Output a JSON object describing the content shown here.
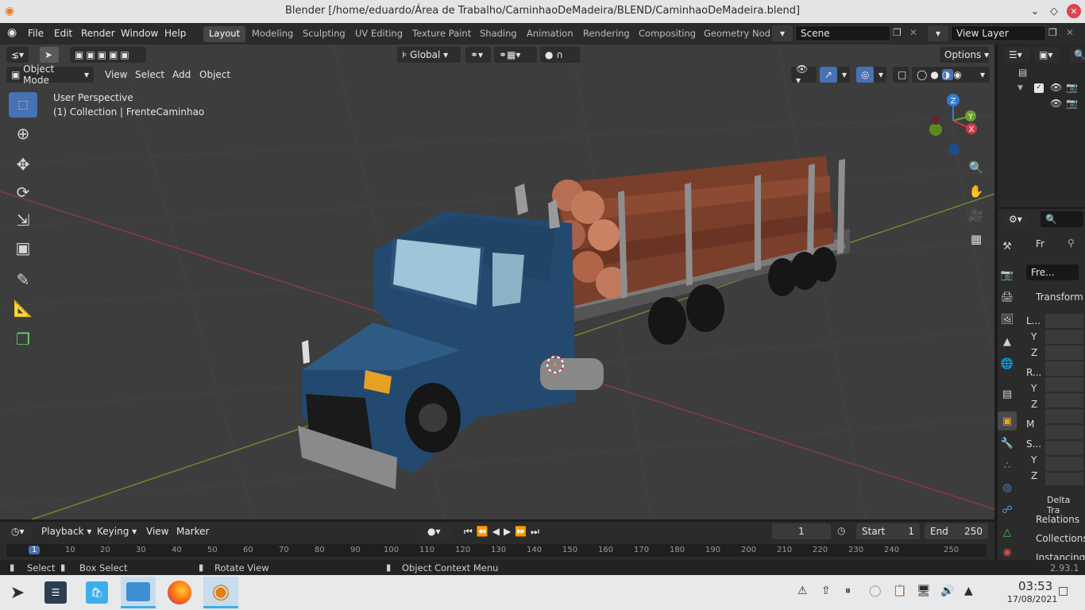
{
  "window": {
    "title": "Blender [/home/eduardo/Área de Trabalho/CaminhaoDeMadeira/BLEND/CaminhaoDeMadeira.blend]",
    "controls": [
      "chevron-down",
      "diamond",
      "close"
    ]
  },
  "menu": [
    "File",
    "Edit",
    "Render",
    "Window",
    "Help"
  ],
  "workspaces": [
    "Layout",
    "Modeling",
    "Sculpting",
    "UV Editing",
    "Texture Paint",
    "Shading",
    "Animation",
    "Rendering",
    "Compositing",
    "Geometry Nod"
  ],
  "active_workspace": "Layout",
  "scene": {
    "label": "Scene",
    "view_layer": "View Layer"
  },
  "toolbar": {
    "orientation": "Global",
    "options": "Options"
  },
  "viewport": {
    "mode": "Object Mode",
    "menus": [
      "View",
      "Select",
      "Add",
      "Object"
    ],
    "overlay_title": "User Perspective",
    "overlay_collection": "(1) Collection | FrenteCaminhao",
    "gizmo": {
      "z": "Z",
      "y": "Y",
      "x": "X"
    }
  },
  "properties": {
    "object_name_short": "Fr",
    "object_field": "Fre...",
    "transform": "Transform",
    "rows": [
      "L...",
      "Y",
      "Z",
      "R...",
      "Y",
      "Z",
      "M",
      "S...",
      "Y",
      "Z"
    ],
    "sections": [
      "Delta Tra",
      "Relations",
      "Collections",
      "Instancing"
    ]
  },
  "timeline": {
    "menus": [
      "Playback",
      "Keying",
      "View",
      "Marker"
    ],
    "current_frame": "1",
    "start_label": "Start",
    "start": "1",
    "end_label": "End",
    "end": "250",
    "ticks": [
      "1",
      "10",
      "20",
      "30",
      "40",
      "50",
      "60",
      "70",
      "80",
      "90",
      "100",
      "110",
      "120",
      "130",
      "140",
      "150",
      "160",
      "170",
      "180",
      "190",
      "200",
      "210",
      "220",
      "230",
      "240",
      "250"
    ]
  },
  "status": {
    "select": "Select",
    "box_select": "Box Select",
    "rotate": "Rotate View",
    "context": "Object Context Menu",
    "version": "2.93.1"
  },
  "taskbar": {
    "time": "03:53",
    "date": "17/08/2021"
  },
  "colors": {
    "accent": "#4772b3",
    "viewport": "#3d3d3d",
    "truck_blue": "#234a6e",
    "log": "#7a3f2b",
    "close": "#da4453"
  }
}
